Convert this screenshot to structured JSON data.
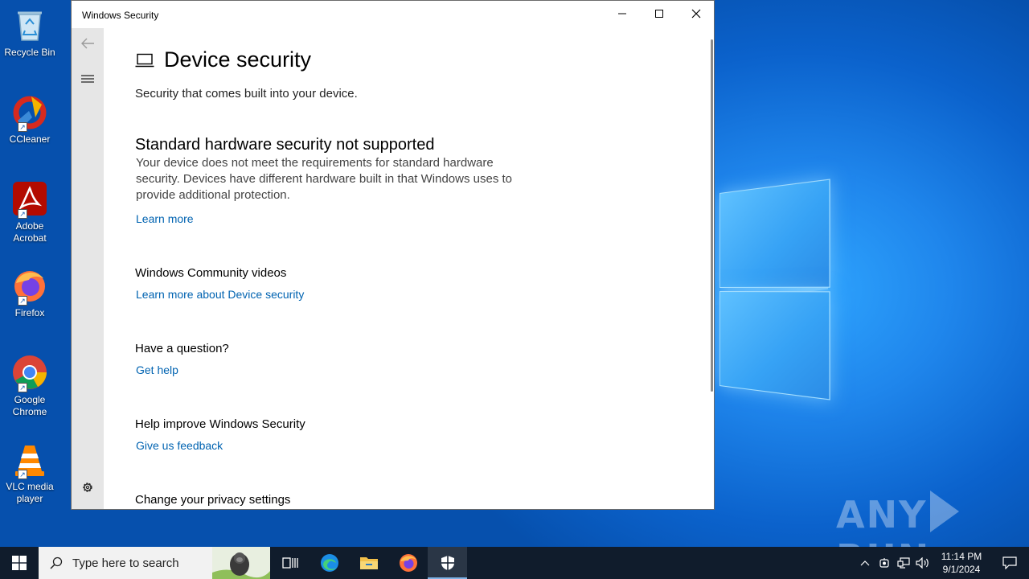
{
  "desktop": {
    "icons": [
      {
        "label": "Recycle Bin",
        "icon": "recycle-bin-icon"
      },
      {
        "label": "CCleaner",
        "icon": "ccleaner-icon"
      },
      {
        "label": "Adobe Acrobat",
        "icon": "adobe-acrobat-icon"
      },
      {
        "label": "Firefox",
        "icon": "firefox-icon"
      },
      {
        "label": "Google Chrome",
        "icon": "chrome-icon"
      },
      {
        "label": "VLC media player",
        "icon": "vlc-icon"
      }
    ],
    "watermark": {
      "left": "ANY",
      "right": "RUN"
    }
  },
  "window": {
    "title": "Windows Security",
    "page_title": "Device security",
    "subtitle": "Security that comes built into your device.",
    "hardware": {
      "heading": "Standard hardware security not supported",
      "body": "Your device does not meet the requirements for standard hardware security. Devices have different hardware built in that Windows uses to provide additional protection.",
      "link": "Learn more"
    },
    "community": {
      "heading": "Windows Community videos",
      "link": "Learn more about Device security"
    },
    "question": {
      "heading": "Have a question?",
      "link": "Get help"
    },
    "improve": {
      "heading": "Help improve Windows Security",
      "link": "Give us feedback"
    },
    "privacy": {
      "heading": "Change your privacy settings"
    }
  },
  "taskbar": {
    "search_placeholder": "Type here to search",
    "time": "11:14 PM",
    "date": "9/1/2024"
  },
  "colors": {
    "link": "#0063b1",
    "taskbar": "#101c2c",
    "rail": "#e6e6e6"
  }
}
